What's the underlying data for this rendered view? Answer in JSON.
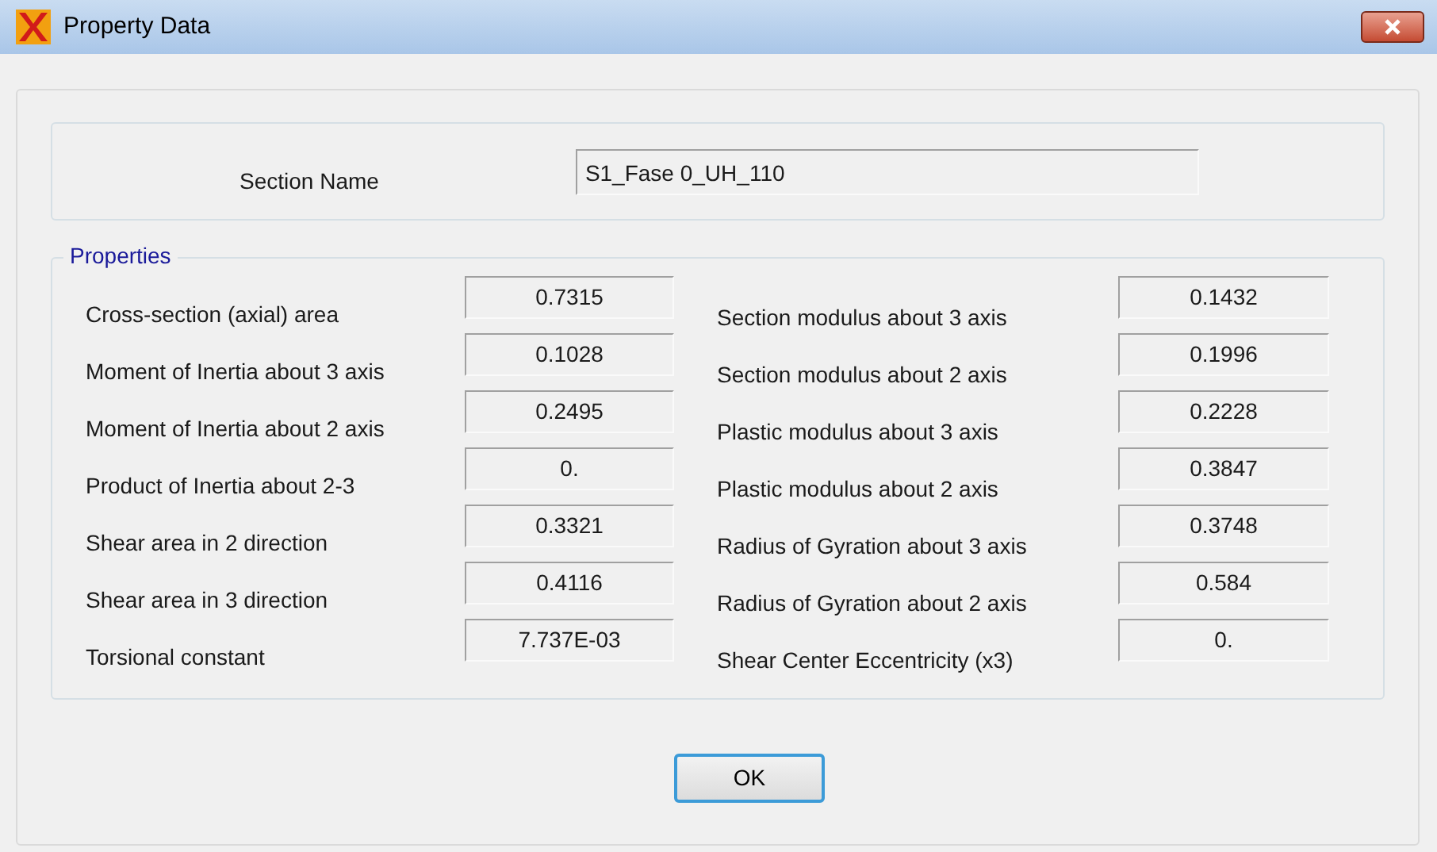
{
  "window": {
    "title": "Property Data"
  },
  "section_name": {
    "label": "Section Name",
    "value": "S1_Fase 0_UH_110"
  },
  "properties": {
    "title": "Properties",
    "left": [
      {
        "label": "Cross-section (axial) area",
        "value": "0.7315"
      },
      {
        "label": "Moment of Inertia about 3 axis",
        "value": "0.1028"
      },
      {
        "label": "Moment of Inertia about 2 axis",
        "value": "0.2495"
      },
      {
        "label": "Product of Inertia about 2-3",
        "value": "0."
      },
      {
        "label": "Shear area in 2 direction",
        "value": "0.3321"
      },
      {
        "label": "Shear area in 3 direction",
        "value": "0.4116"
      },
      {
        "label": "Torsional constant",
        "value": "7.737E-03"
      }
    ],
    "right": [
      {
        "label": "Section modulus about 3 axis",
        "value": "0.1432"
      },
      {
        "label": "Section modulus about 2 axis",
        "value": "0.1996"
      },
      {
        "label": "Plastic modulus about 3 axis",
        "value": "0.2228"
      },
      {
        "label": "Plastic modulus about 2 axis",
        "value": "0.3847"
      },
      {
        "label": "Radius of Gyration about 3 axis",
        "value": "0.3748"
      },
      {
        "label": "Radius of Gyration about 2 axis",
        "value": "0.584"
      },
      {
        "label": "Shear Center Eccentricity (x3)",
        "value": "0."
      }
    ]
  },
  "buttons": [
    "OK"
  ]
}
